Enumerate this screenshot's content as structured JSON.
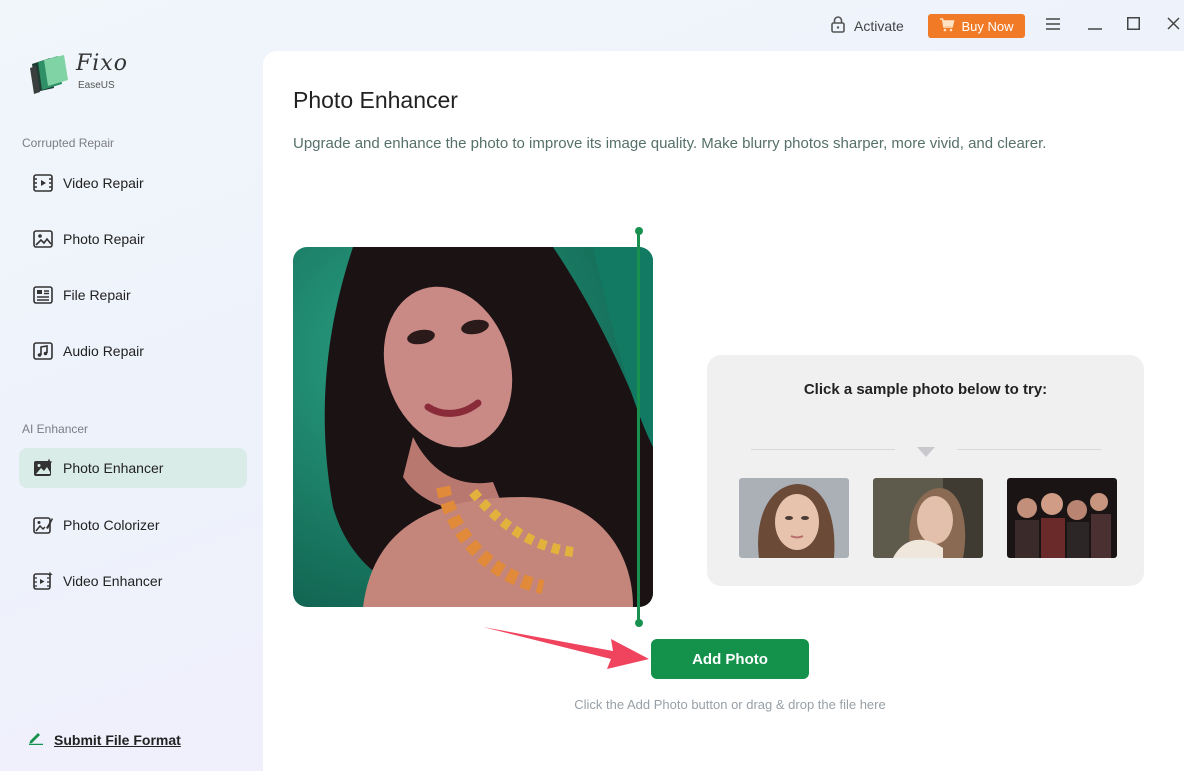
{
  "header": {
    "activate_label": "Activate",
    "buy_now_label": "Buy Now"
  },
  "logo": {
    "name": "Fixo",
    "sub": "EaseUS"
  },
  "sidebar": {
    "sections": [
      {
        "label": "Corrupted Repair"
      },
      {
        "label": "AI Enhancer"
      }
    ],
    "items": [
      {
        "label": "Video Repair",
        "icon": "video-repair-icon"
      },
      {
        "label": "Photo Repair",
        "icon": "photo-repair-icon"
      },
      {
        "label": "File Repair",
        "icon": "file-repair-icon"
      },
      {
        "label": "Audio Repair",
        "icon": "audio-repair-icon"
      },
      {
        "label": "Photo Enhancer",
        "icon": "photo-enhancer-icon",
        "active": true
      },
      {
        "label": "Photo Colorizer",
        "icon": "photo-colorizer-icon"
      },
      {
        "label": "Video Enhancer",
        "icon": "video-enhancer-icon"
      }
    ],
    "submit_label": "Submit File Format"
  },
  "main": {
    "title": "Photo Enhancer",
    "description": "Upgrade and enhance the photo to improve its image quality. Make blurry photos sharper, more vivid, and clearer.",
    "samples_title": "Click a sample photo below to try:",
    "add_photo_label": "Add Photo",
    "hint": "Click the Add Photo button or drag & drop the file here"
  },
  "colors": {
    "accent_green": "#14924c",
    "buy_now_orange": "#f07a26",
    "active_nav_bg": "#d9ece8",
    "arrow_red": "#f0435e"
  }
}
